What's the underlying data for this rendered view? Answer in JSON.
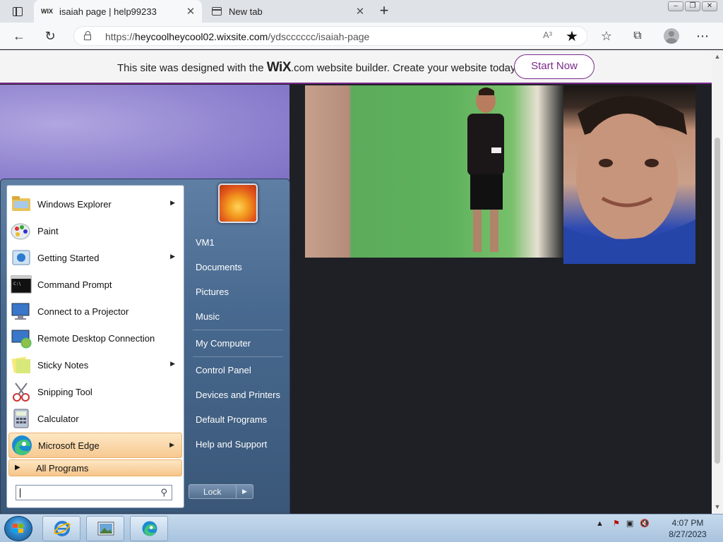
{
  "browser": {
    "tabs": [
      {
        "favicon": "WIX",
        "title": "isaiah page | help99233",
        "active": true
      },
      {
        "title": "New tab",
        "active": false
      }
    ],
    "url_prefix": "https://",
    "url_host": "heycoolheycool02.wixsite.com",
    "url_path": "/ydscccccc/isaiah-page",
    "read_aloud": "A³"
  },
  "wix_banner": {
    "text_before": "This site was designed with the",
    "logo": "WiX",
    "logo_suffix": ".com",
    "text_after": "website builder. Create your website today.",
    "button": "Start Now",
    "accent_color": "#7a2a8a"
  },
  "start_menu": {
    "programs": [
      {
        "label": "Windows Explorer",
        "icon": "folder-explorer-icon",
        "submenu": true
      },
      {
        "label": "Paint",
        "icon": "paint-icon",
        "submenu": false
      },
      {
        "label": "Getting Started",
        "icon": "getting-started-icon",
        "submenu": true
      },
      {
        "label": "Command Prompt",
        "icon": "command-prompt-icon",
        "submenu": false
      },
      {
        "label": "Connect to a Projector",
        "icon": "projector-icon",
        "submenu": false
      },
      {
        "label": "Remote Desktop Connection",
        "icon": "remote-desktop-icon",
        "submenu": false
      },
      {
        "label": "Sticky Notes",
        "icon": "sticky-notes-icon",
        "submenu": true
      },
      {
        "label": "Snipping Tool",
        "icon": "snipping-tool-icon",
        "submenu": false
      },
      {
        "label": "Calculator",
        "icon": "calculator-icon",
        "submenu": false
      },
      {
        "label": "Microsoft Edge",
        "icon": "edge-icon",
        "submenu": true,
        "highlighted": true
      }
    ],
    "all_programs": "All Programs",
    "places": [
      "VM1",
      "Documents",
      "Pictures",
      "Music",
      "My Computer",
      "Control Panel",
      "Devices and Printers",
      "Default Programs",
      "Help and Support"
    ],
    "lock_button": "Lock",
    "search_placeholder": ""
  },
  "taskbar": {
    "time": "4:07 PM",
    "date": "8/27/2023",
    "pinned": [
      "internet-explorer-icon",
      "photo-viewer-icon",
      "edge-icon"
    ]
  }
}
